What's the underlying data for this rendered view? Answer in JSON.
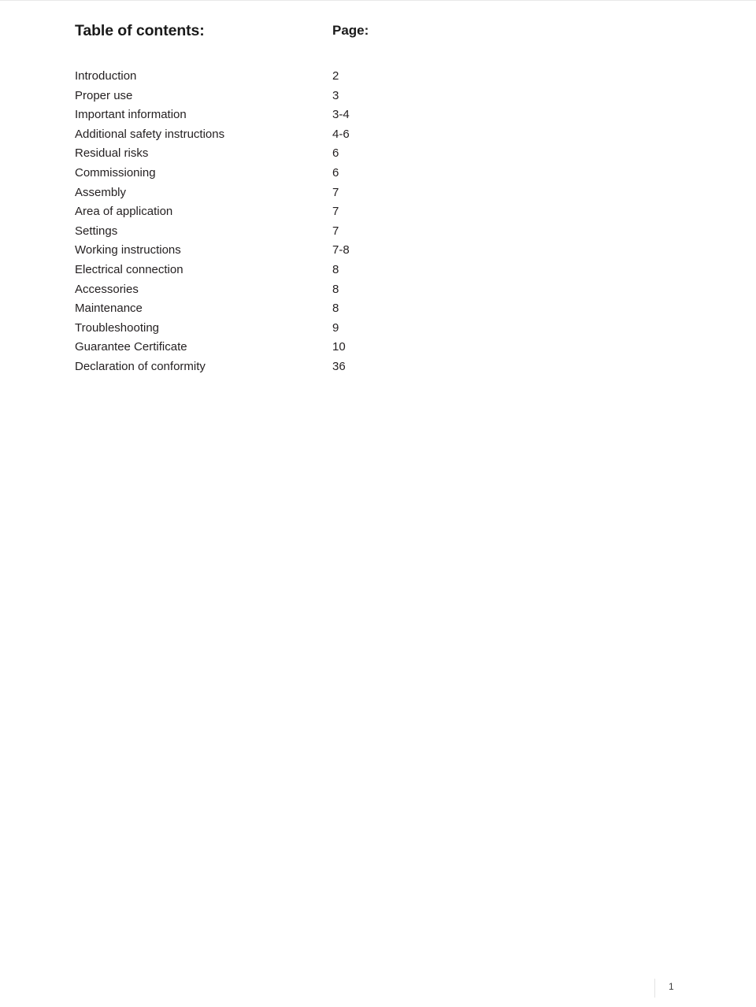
{
  "document": {
    "heading": "Table of contents:",
    "page_column_header": "Page:",
    "entries": [
      {
        "label": "Introduction",
        "page": "2"
      },
      {
        "label": "Proper use",
        "page": "3"
      },
      {
        "label": "Important information",
        "page": "3-4"
      },
      {
        "label": "Additional safety instructions",
        "page": "4-6"
      },
      {
        "label": "Residual risks",
        "page": "6"
      },
      {
        "label": "Commissioning",
        "page": "6"
      },
      {
        "label": "Assembly",
        "page": "7"
      },
      {
        "label": "Area of application",
        "page": "7"
      },
      {
        "label": "Settings",
        "page": "7"
      },
      {
        "label": "Working instructions",
        "page": "7-8"
      },
      {
        "label": "Electrical connection",
        "page": "8"
      },
      {
        "label": "Accessories",
        "page": "8"
      },
      {
        "label": "Maintenance",
        "page": "8"
      },
      {
        "label": "Troubleshooting",
        "page": "9"
      },
      {
        "label": "Guarantee Certificate",
        "page": "10"
      },
      {
        "label": "Declaration of conformity",
        "page": "36"
      }
    ]
  },
  "footer": {
    "page_number": "1"
  },
  "colors": {
    "text": "#231f20",
    "heading": "#1a1a1a",
    "rule": "#e8e8e8",
    "background": "#ffffff"
  }
}
